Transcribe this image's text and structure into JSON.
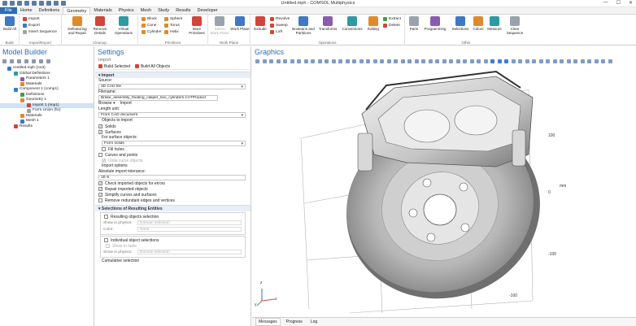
{
  "window": {
    "title": "Untitled.mph - COMSOL Multiphysics",
    "min": "—",
    "max": "☐",
    "close": "✕"
  },
  "menu": {
    "tabs": [
      "File",
      "Home",
      "Definitions",
      "Geometry",
      "Materials",
      "Physics",
      "Mesh",
      "Study",
      "Results",
      "Developer"
    ],
    "active": "Geometry"
  },
  "ribbon": {
    "build": {
      "label": "Build All",
      "group": "Build"
    },
    "import_export": {
      "items": [
        "Import",
        "Export",
        "Insert Sequence"
      ],
      "group": "Import/Export"
    },
    "cleanup": {
      "items": [
        "Defeaturing and Repair",
        "Remove Details",
        "Virtual Operations"
      ],
      "group": "Cleanup"
    },
    "primitives": {
      "items": [
        "Block",
        "Sphere",
        "Cone",
        "Torus",
        "Cylinder",
        "Helix"
      ],
      "more": "More Primitives",
      "group": "Primitives"
    },
    "workplane": {
      "items": [
        "Select Work Plane",
        "Work Plane"
      ],
      "group": "Work Plane"
    },
    "operations": {
      "extrude": "Extrude",
      "revolve": "Revolve",
      "sweep": "Sweep",
      "loft": "Loft",
      "items": [
        "Booleans and Partitions",
        "Transforms",
        "Conversions",
        "Editing"
      ],
      "extract": "Extract",
      "delete": "Delete",
      "group": "Operations"
    },
    "other": {
      "items": [
        "Parts",
        "Programming",
        "Selections",
        "Colors",
        "Measure",
        "Clear Sequence"
      ],
      "group": "Other"
    }
  },
  "model_builder": {
    "title": "Model Builder",
    "tree": [
      {
        "label": "Untitled.mph (root)",
        "level": 0,
        "icon": "root-icon",
        "color": "#3f78c4"
      },
      {
        "label": "Global Definitions",
        "level": 1,
        "icon": "globe-icon",
        "color": "#2d9aa3"
      },
      {
        "label": "Parameters 1",
        "level": 2,
        "icon": "parameters-icon",
        "color": "#8b5bb0"
      },
      {
        "label": "Materials",
        "level": 2,
        "icon": "materials-icon",
        "color": "#e08a2c"
      },
      {
        "label": "Component 1 (comp1)",
        "level": 1,
        "icon": "component-icon",
        "color": "#3f78c4"
      },
      {
        "label": "Definitions",
        "level": 2,
        "icon": "definitions-icon",
        "color": "#4e9a4a"
      },
      {
        "label": "Geometry 1",
        "level": 2,
        "icon": "geometry-icon",
        "color": "#e08a2c"
      },
      {
        "label": "Import 1 (imp1)",
        "level": 3,
        "icon": "import-icon",
        "color": "#d0463a",
        "selected": true
      },
      {
        "label": "Form Union (fin)",
        "level": 3,
        "icon": "form-union-icon",
        "color": "#9aa3ad"
      },
      {
        "label": "Materials",
        "level": 2,
        "icon": "materials-icon",
        "color": "#e08a2c"
      },
      {
        "label": "Mesh 1",
        "level": 2,
        "icon": "mesh-icon",
        "color": "#3f78c4"
      },
      {
        "label": "Results",
        "level": 1,
        "icon": "results-icon",
        "color": "#d0463a"
      }
    ]
  },
  "settings": {
    "title": "Settings",
    "subtitle": "Import",
    "build_selected": "Build Selected",
    "build_all": "Build All Objects",
    "sec_import": "Import",
    "source_label": "Source:",
    "source_value": "3D CAD file",
    "filename_label": "Filename:",
    "filename_value": "Brake_assembly_floating_caliper_two_cylinders.CATProduct",
    "browse": "Browse",
    "import_btn": "Import",
    "length_label": "Length unit:",
    "length_value": "From CAD document",
    "objects_label": "Objects to import",
    "solids": "Solids",
    "surfaces": "Surfaces",
    "for_surface_label": "For surface objects:",
    "for_surface_value": "Form solids",
    "fill_holes": "Fill holes",
    "curves_points": "Curves and points",
    "unite_curve": "Unite curve objects",
    "import_options": "Import options",
    "tol_label": "Absolute import tolerance:",
    "tol_value": "1E-5",
    "check_errors": "Check imported objects for errors",
    "repair": "Repair imported objects",
    "simplify": "Simplify curves and surfaces",
    "remove_redundant": "Remove redundant edges and vertices",
    "sec_selections": "Selections of Resulting Entities",
    "resulting_sel": "Resulting objects selection",
    "show_physics": "Show in physics:",
    "domain_sel": "Domain selection",
    "color_label": "Color:",
    "color_value": "None",
    "individual_sel": "Individual object selections",
    "show_in_table": "Show in table",
    "cumulative_sel": "Cumulative selection"
  },
  "graphics": {
    "title": "Graphics",
    "axis_labels": [
      "100",
      "0",
      "-100",
      "-100",
      "mm"
    ],
    "triad": {
      "z": "z",
      "x": "x",
      "y": "y"
    }
  },
  "bottom_tabs": [
    "Messages",
    "Progress",
    "Log"
  ]
}
